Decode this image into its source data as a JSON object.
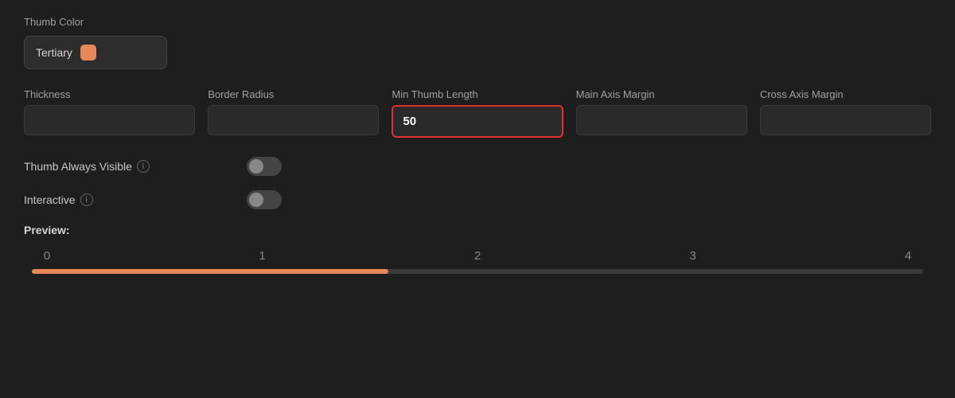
{
  "thumb_color": {
    "label": "Thumb Color",
    "dropdown_label": "Tertiary",
    "swatch_color": "#e8875a"
  },
  "fields": {
    "thickness": {
      "label": "Thickness",
      "value": "",
      "placeholder": ""
    },
    "border_radius": {
      "label": "Border Radius",
      "value": "",
      "placeholder": ""
    },
    "min_thumb_length": {
      "label": "Min Thumb Length",
      "value": "50",
      "placeholder": "",
      "highlighted": true
    },
    "main_axis_margin": {
      "label": "Main Axis Margin",
      "value": "",
      "placeholder": ""
    },
    "cross_axis_margin": {
      "label": "Cross Axis Margin",
      "value": "",
      "placeholder": ""
    }
  },
  "toggles": {
    "thumb_always_visible": {
      "label": "Thumb Always Visible",
      "enabled": false
    },
    "interactive": {
      "label": "Interactive",
      "enabled": false
    }
  },
  "preview": {
    "label": "Preview:",
    "ticks": [
      "0",
      "1",
      "2",
      "3",
      "4"
    ],
    "fill_percent": 40
  },
  "info_icon_label": "i"
}
